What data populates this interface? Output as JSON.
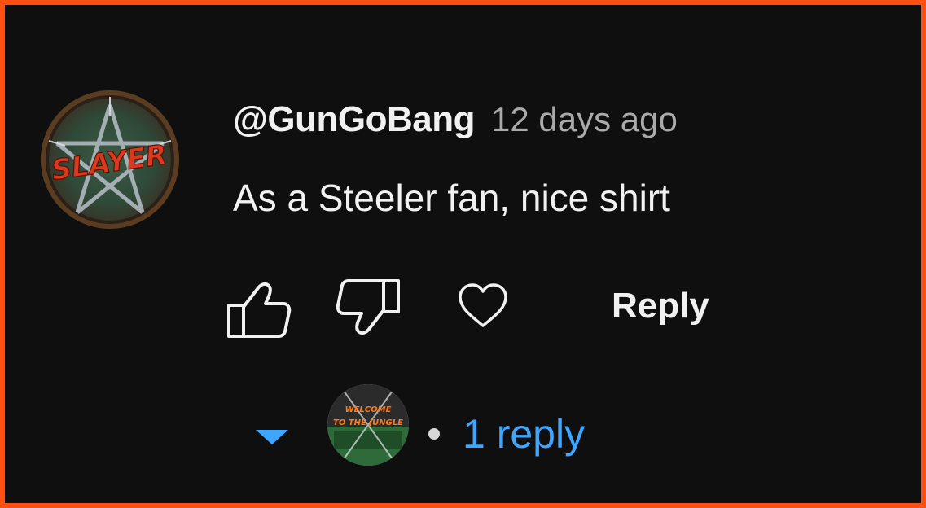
{
  "comment": {
    "author": "@GunGoBang",
    "timestamp": "12 days ago",
    "text": "As a Steeler fan, nice shirt",
    "avatar_text": "SLAYER"
  },
  "actions": {
    "like_icon": "thumbs-up-icon",
    "dislike_icon": "thumbs-down-icon",
    "heart_icon": "heart-icon",
    "reply_label": "Reply"
  },
  "replies": {
    "expand_icon": "caret-down-icon",
    "count_label": "1 reply",
    "reply_avatar_text": [
      "WELCOME",
      "TO THE JUNGLE"
    ]
  },
  "colors": {
    "background": "#0f0f0f",
    "frame_border": "#ff4f12",
    "text_primary": "#f1f1f1",
    "text_secondary": "#aaaaaa",
    "link_blue": "#3ea6ff"
  }
}
